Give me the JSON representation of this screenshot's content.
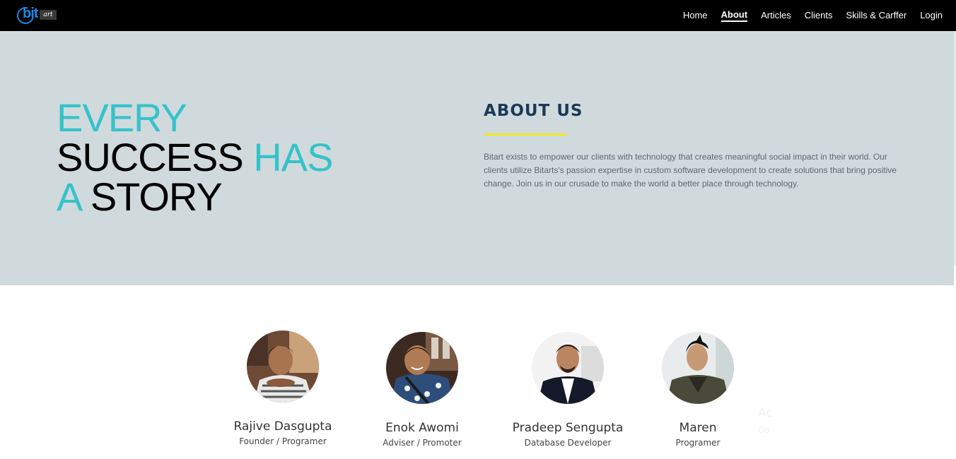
{
  "brand": {
    "logo_main": "bit",
    "logo_sub": "art"
  },
  "nav": {
    "items": [
      {
        "label": "Home",
        "active": false
      },
      {
        "label": "About",
        "active": true
      },
      {
        "label": "Articles",
        "active": false
      },
      {
        "label": "Clients",
        "active": false
      },
      {
        "label": "Skills & Carffer",
        "active": false
      },
      {
        "label": "Login",
        "active": false
      }
    ]
  },
  "hero": {
    "line1_teal": "EVERY",
    "line2_black": "SUCCESS",
    "line2_teal": "HAS",
    "line3_teal": "A",
    "line3_black": "STORY",
    "about_heading": "ABOUT US",
    "about_text": "Bitart exists to empower our clients with technology that creates meaningful social impact in their world. Our clients utilize Bitarts's passion expertise in custom software development to create solutions that bring positive change. Join us in our crusade to make the world a better place through technology."
  },
  "team": {
    "members": [
      {
        "name": "Rajive Dasgupta",
        "role": "Founder / Programer"
      },
      {
        "name": "Enok Awomi",
        "role": "Adviser / Promoter"
      },
      {
        "name": "Pradeep Sengupta",
        "role": "Database Developer"
      },
      {
        "name": "Maren",
        "role": "Programer"
      }
    ],
    "ghost_name": "Ac",
    "ghost_role": "Go"
  },
  "colors": {
    "teal": "#36c2c9",
    "hero_bg": "#d0dadd",
    "heading_navy": "#1b3a57",
    "underline_yellow": "#f5e623",
    "nav_bg": "#000000"
  }
}
